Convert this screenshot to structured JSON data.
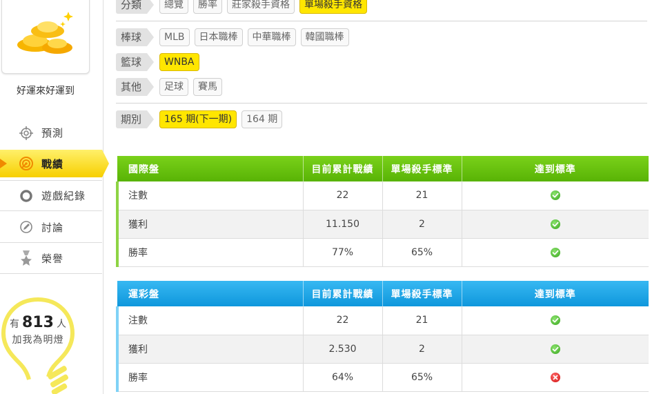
{
  "sidebar": {
    "username": "好運來好運到",
    "nav": [
      {
        "label": "預測",
        "icon": "target-icon"
      },
      {
        "label": "戰績",
        "icon": "bullseye-icon"
      },
      {
        "label": "遊戲紀錄",
        "icon": "ring-icon"
      },
      {
        "label": "討論",
        "icon": "chat-edit-icon"
      },
      {
        "label": "榮譽",
        "icon": "medal-icon"
      }
    ],
    "fans": {
      "prefix": "有",
      "count": "813",
      "suffix": "人",
      "line2": "加我為明燈"
    }
  },
  "filters": {
    "category": {
      "label": "分類",
      "options": [
        "總覽",
        "勝率",
        "莊家殺手資格",
        "單場殺手資格"
      ],
      "active": "單場殺手資格"
    },
    "baseball": {
      "label": "棒球",
      "options": [
        "MLB",
        "日本職棒",
        "中華職棒",
        "韓國職棒"
      ]
    },
    "basketball": {
      "label": "籃球",
      "options": [
        "WNBA"
      ],
      "active": "WNBA"
    },
    "other": {
      "label": "其他",
      "options": [
        "足球",
        "賽馬"
      ]
    },
    "period": {
      "label": "期別",
      "options": [
        "165 期(下一期)",
        "164 期"
      ],
      "active": "165 期(下一期)"
    }
  },
  "tables": {
    "intl": {
      "headers": [
        "國際盤",
        "目前累計戰績",
        "單場殺手標準",
        "達到標準"
      ],
      "rows": [
        {
          "name": "注數",
          "current": "22",
          "standard": "21",
          "met": true
        },
        {
          "name": "獲利",
          "current": "11.150",
          "standard": "2",
          "met": true
        },
        {
          "name": "勝率",
          "current": "77%",
          "standard": "65%",
          "met": true
        }
      ]
    },
    "lottery": {
      "headers": [
        "運彩盤",
        "目前累計戰績",
        "單場殺手標準",
        "達到標準"
      ],
      "rows": [
        {
          "name": "注數",
          "current": "22",
          "standard": "21",
          "met": true
        },
        {
          "name": "獲利",
          "current": "2.530",
          "standard": "2",
          "met": true
        },
        {
          "name": "勝率",
          "current": "64%",
          "standard": "65%",
          "met": false
        }
      ]
    }
  },
  "colors": {
    "accent_yellow": "#ffe600",
    "intl_header": "#62bb0a",
    "lottery_header": "#1aa6e6",
    "ok": "#3aa61e",
    "fail": "#d10f0f"
  }
}
